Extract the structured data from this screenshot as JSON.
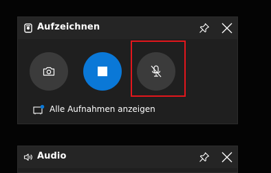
{
  "capture_widget": {
    "title": "Aufzeichnen",
    "icons": {
      "header": "capture-icon",
      "pin": "pin-icon",
      "close": "close-icon"
    },
    "buttons": {
      "screenshot": {
        "icon": "camera-icon"
      },
      "stop_recording": {
        "icon": "stop-icon"
      },
      "microphone": {
        "icon": "microphone-muted-icon"
      }
    },
    "show_all_captures_label": "Alle Aufnahmen anzeigen",
    "show_all_icon": "gallery-icon"
  },
  "audio_widget": {
    "title": "Audio",
    "icons": {
      "header": "speaker-icon",
      "pin": "pin-icon",
      "close": "close-icon"
    }
  },
  "colors": {
    "background": "#040404",
    "panel": "#1f1f1f",
    "header": "#252525",
    "button_gray": "#3b3b3b",
    "accent_blue": "#0a78d7",
    "highlight_red": "#e4161c"
  }
}
